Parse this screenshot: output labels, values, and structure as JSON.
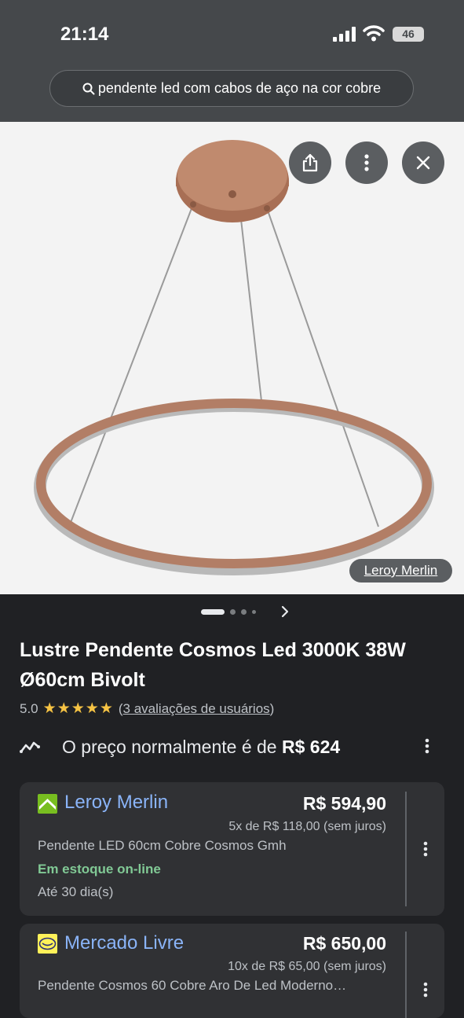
{
  "status_bar": {
    "time": "21:14",
    "battery": "46"
  },
  "search": {
    "query": "pendente led com cabos de aço na cor cobre"
  },
  "image": {
    "source_label": "Leroy Merlin"
  },
  "product": {
    "title": "Lustre Pendente Cosmos Led 3000K 38W Ø60cm Bivolt",
    "rating_value": "5.0",
    "rating_stars": 5,
    "reviews_link": "3 avaliações de usuários",
    "price_hint_text": "O preço normalmente é de",
    "price_hint_value": "R$ 624"
  },
  "offers": [
    {
      "store": "Leroy Merlin",
      "price": "R$ 594,90",
      "installments": "5x de R$ 118,00 (sem juros)",
      "description": "Pendente LED 60cm Cobre Cosmos Gmh",
      "stock": "Em estoque on-line",
      "shipping": "Até 30 dia(s)"
    },
    {
      "store": "Mercado Livre",
      "price": "R$ 650,00",
      "installments": "10x de R$ 65,00 (sem juros)",
      "description": "Pendente Cosmos 60 Cobre Aro De Led Moderno…"
    }
  ],
  "icons": [
    "search-icon",
    "share-icon",
    "more-vert-icon",
    "close-icon",
    "chevron-right-icon",
    "trend-icon",
    "star-icon"
  ]
}
